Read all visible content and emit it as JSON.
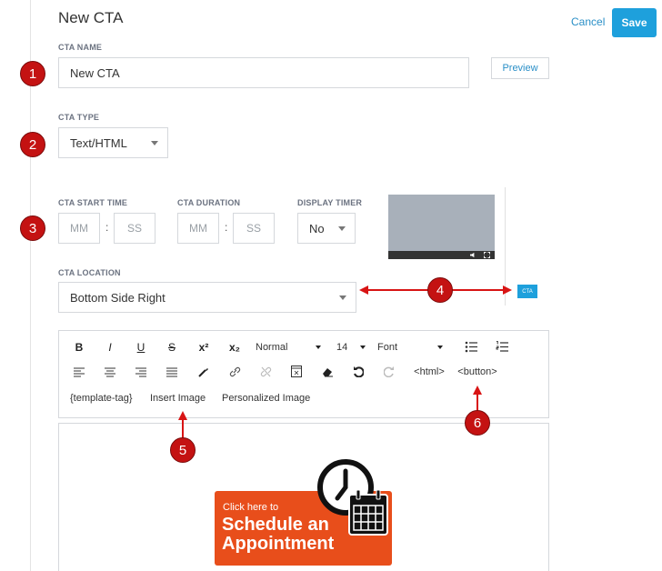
{
  "header": {
    "title": "New CTA",
    "cancel_label": "Cancel",
    "save_label": "Save"
  },
  "cta_name": {
    "label": "CTA NAME",
    "value": "New CTA",
    "preview_label": "Preview"
  },
  "cta_type": {
    "label": "CTA TYPE",
    "value": "Text/HTML"
  },
  "timing": {
    "start_label": "CTA START TIME",
    "duration_label": "CTA DURATION",
    "timer_label": "DISPLAY TIMER",
    "mm": "MM",
    "ss": "SS",
    "colon": ":",
    "timer_value": "No"
  },
  "location": {
    "label": "CTA LOCATION",
    "value": "Bottom Side Right"
  },
  "preview": {
    "chip_label": "CTA"
  },
  "toolbar": {
    "bold": "B",
    "italic": "I",
    "underline": "U",
    "strike": "S",
    "superscript": "x²",
    "subscript": "x₂",
    "format": "Normal",
    "size": "14",
    "font": "Font",
    "html_tag": "<html>",
    "button_tag": "<button>",
    "template_tag": "{template-tag}",
    "insert_image": "Insert Image",
    "personalized_image": "Personalized Image"
  },
  "editor": {
    "cta_small": "Click here to",
    "cta_line1": "Schedule an",
    "cta_line2": "Appointment"
  },
  "badges": [
    "1",
    "2",
    "3",
    "4",
    "5",
    "6"
  ],
  "colors": {
    "accent": "#1ea0dc",
    "badge": "#c41212",
    "cta_orange": "#e84e1b"
  }
}
